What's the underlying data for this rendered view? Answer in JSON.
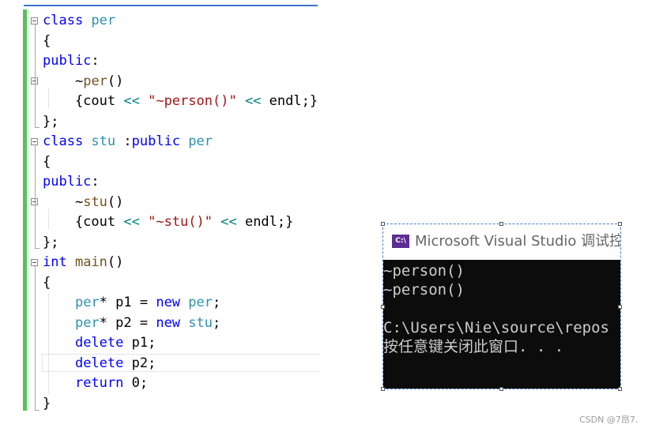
{
  "editor": {
    "lines": [
      [
        {
          "t": "class ",
          "c": "kw"
        },
        {
          "t": "per",
          "c": "ty"
        }
      ],
      [
        {
          "t": "{",
          "c": ""
        }
      ],
      [
        {
          "t": "public",
          "c": "kw"
        },
        {
          "t": ":",
          "c": ""
        }
      ],
      [
        {
          "t": "    ",
          "c": ""
        },
        {
          "t": "~",
          "c": ""
        },
        {
          "t": "per",
          "c": "fn"
        },
        {
          "t": "()",
          "c": ""
        }
      ],
      [
        {
          "t": "    {cout ",
          "c": ""
        },
        {
          "t": "<<",
          "c": "op"
        },
        {
          "t": " ",
          "c": ""
        },
        {
          "t": "\"~person()\"",
          "c": "str"
        },
        {
          "t": " ",
          "c": ""
        },
        {
          "t": "<<",
          "c": "op"
        },
        {
          "t": " endl;}",
          "c": ""
        }
      ],
      [
        {
          "t": "};",
          "c": ""
        }
      ],
      [
        {
          "t": "class ",
          "c": "kw"
        },
        {
          "t": "stu",
          "c": "ty"
        },
        {
          "t": " :",
          "c": ""
        },
        {
          "t": "public ",
          "c": "kw"
        },
        {
          "t": "per",
          "c": "ty"
        }
      ],
      [
        {
          "t": "{",
          "c": ""
        }
      ],
      [
        {
          "t": "public",
          "c": "kw"
        },
        {
          "t": ":",
          "c": ""
        }
      ],
      [
        {
          "t": "    ",
          "c": ""
        },
        {
          "t": "~",
          "c": ""
        },
        {
          "t": "stu",
          "c": "fn"
        },
        {
          "t": "()",
          "c": ""
        }
      ],
      [
        {
          "t": "    {cout ",
          "c": ""
        },
        {
          "t": "<<",
          "c": "op"
        },
        {
          "t": " ",
          "c": ""
        },
        {
          "t": "\"~stu()\"",
          "c": "str"
        },
        {
          "t": " ",
          "c": ""
        },
        {
          "t": "<<",
          "c": "op"
        },
        {
          "t": " endl;}",
          "c": ""
        }
      ],
      [
        {
          "t": "};",
          "c": ""
        }
      ],
      [
        {
          "t": "int ",
          "c": "kw"
        },
        {
          "t": "main",
          "c": "fn"
        },
        {
          "t": "()",
          "c": ""
        }
      ],
      [
        {
          "t": "{",
          "c": ""
        }
      ],
      [
        {
          "t": "    ",
          "c": ""
        },
        {
          "t": "per",
          "c": "ty"
        },
        {
          "t": "* p1 = ",
          "c": ""
        },
        {
          "t": "new ",
          "c": "kw"
        },
        {
          "t": "per",
          "c": "ty"
        },
        {
          "t": ";",
          "c": ""
        }
      ],
      [
        {
          "t": "    ",
          "c": ""
        },
        {
          "t": "per",
          "c": "ty"
        },
        {
          "t": "* p2 = ",
          "c": ""
        },
        {
          "t": "new ",
          "c": "kw"
        },
        {
          "t": "stu",
          "c": "ty"
        },
        {
          "t": ";",
          "c": ""
        }
      ],
      [
        {
          "t": "    ",
          "c": ""
        },
        {
          "t": "delete",
          "c": "kw"
        },
        {
          "t": " p1;",
          "c": ""
        }
      ],
      [
        {
          "t": "    ",
          "c": ""
        },
        {
          "t": "delete",
          "c": "kw"
        },
        {
          "t": " p2;",
          "c": ""
        }
      ],
      [
        {
          "t": "    ",
          "c": ""
        },
        {
          "t": "return",
          "c": "kw"
        },
        {
          "t": " 0;",
          "c": ""
        }
      ],
      [
        {
          "t": "}",
          "c": ""
        }
      ]
    ]
  },
  "console": {
    "title": "Microsoft Visual Studio 调试控",
    "icon_label": "C:\\",
    "icon_name": "console-app-icon",
    "output": [
      "~person()",
      "~person()",
      "",
      "C:\\Users\\Nie\\source\\repos",
      "按任意键关闭此窗口. . ."
    ]
  },
  "watermark": "CSDN @7昂7.",
  "colors": {
    "keyword": "#0000ff",
    "type": "#2b91af",
    "string": "#a31515",
    "operator": "#008080",
    "function": "#74531f",
    "gutter_changed": "#57c05c",
    "console_bg": "#0c0c0c",
    "console_text": "#cccccc"
  }
}
